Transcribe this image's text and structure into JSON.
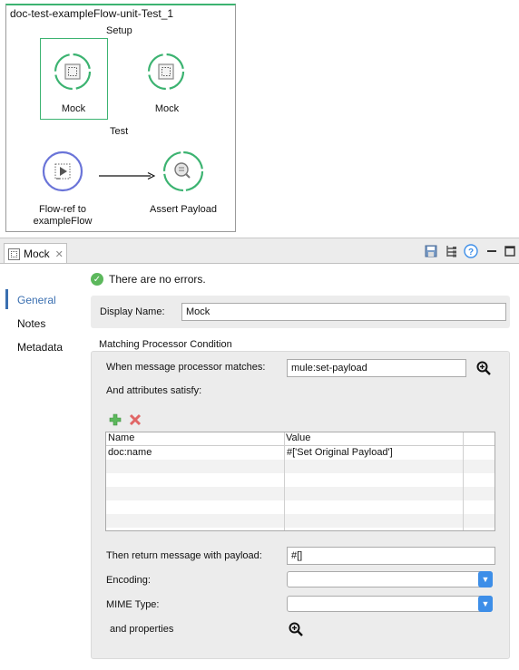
{
  "flow": {
    "title": "doc-test-exampleFlow-unit-Test_1",
    "setup_label": "Setup",
    "test_label": "Test",
    "nodes": {
      "mock1": "Mock",
      "mock2": "Mock",
      "flowref": "Flow-ref to exampleFlow",
      "assert": "Assert Payload"
    }
  },
  "panel": {
    "tab_label": "Mock",
    "tab_close": "✕",
    "toolbar_icons": [
      "save-icon",
      "tree-icon",
      "help-icon",
      "minimize-icon",
      "maximize-icon"
    ],
    "sidebar": {
      "items": [
        {
          "label": "General",
          "active": true
        },
        {
          "label": "Notes",
          "active": false
        },
        {
          "label": "Metadata",
          "active": false
        }
      ]
    },
    "status_text": "There are no errors.",
    "display_name_label": "Display Name:",
    "display_name_value": "Mock",
    "matching_title": "Matching Processor Condition",
    "matches_label": "When message processor matches:",
    "matches_value": "mule:set-payload",
    "attributes_label": "And attributes satisfy:",
    "table": {
      "headers": [
        "Name",
        "Value"
      ],
      "rows": [
        {
          "name": "doc:name",
          "value": "#['Set Original Payload']"
        }
      ]
    },
    "return_label": "Then return message with payload:",
    "return_value": "#[]",
    "encoding_label": "Encoding:",
    "encoding_value": "",
    "mime_label": "MIME Type:",
    "mime_value": "",
    "properties_label": "and properties"
  },
  "colors": {
    "mock_green": "#3cb371",
    "flowref_blue": "#6a74d8",
    "accent_blue": "#3d8ee8",
    "active_nav": "#3a6fb0"
  }
}
